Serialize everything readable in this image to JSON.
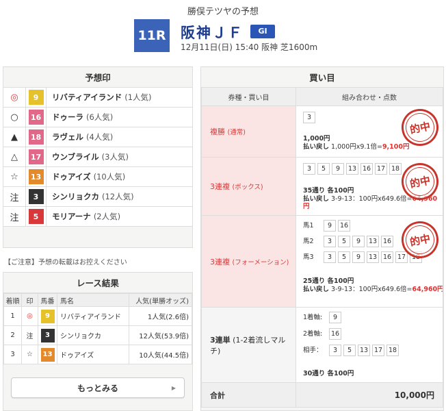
{
  "header": {
    "subtitle": "勝俣テツヤの予想",
    "race_no": "11R",
    "race_name": "阪神ＪＦ",
    "grade": "GI",
    "info": "12月11日(日) 15:40 阪神 芝1600m"
  },
  "prediction": {
    "title": "予想印",
    "rows": [
      {
        "mark": "◎",
        "num": "9",
        "color": "#e5c22b",
        "name": "リバティアイランド",
        "pop": "(1人気)"
      },
      {
        "mark": "○",
        "num": "16",
        "color": "#e2688a",
        "name": "ドゥーラ",
        "pop": "(6人気)"
      },
      {
        "mark": "▲",
        "num": "18",
        "color": "#e2688a",
        "name": "ラヴェル",
        "pop": "(4人気)"
      },
      {
        "mark": "△",
        "num": "17",
        "color": "#e2688a",
        "name": "ウンブライル",
        "pop": "(3人気)"
      },
      {
        "mark": "☆",
        "num": "13",
        "color": "#e28a2c",
        "name": "ドゥアイズ",
        "pop": "(10人気)"
      },
      {
        "mark": "注",
        "num": "3",
        "color": "#333333",
        "name": "シンリョクカ",
        "pop": "(12人気)"
      },
      {
        "mark": "注",
        "num": "5",
        "color": "#d9383a",
        "name": "モリアーナ",
        "pop": "(2人気)"
      }
    ],
    "note": "【ご注意】予想の転載はお控えください"
  },
  "result": {
    "title": "レース結果",
    "headers": [
      "着順",
      "印",
      "馬番",
      "馬名",
      "人気(単勝オッズ)"
    ],
    "rows": [
      {
        "rank": "1",
        "mark": "◎",
        "num": "9",
        "color": "#e5c22b",
        "name": "リバティアイランド",
        "pop": "1人気(2.6倍)"
      },
      {
        "rank": "2",
        "mark": "注",
        "num": "3",
        "color": "#333333",
        "name": "シンリョクカ",
        "pop": "12人気(53.9倍)"
      },
      {
        "rank": "3",
        "mark": "☆",
        "num": "13",
        "color": "#e28a2c",
        "name": "ドゥアイズ",
        "pop": "10人気(44.5倍)"
      }
    ],
    "more": "もっとみる"
  },
  "bets": {
    "title": "買い目",
    "col1": "券種・買い目",
    "col2": "組み合わせ・点数",
    "hit_label": "的中",
    "b1": {
      "type": "複勝",
      "type_sub": "(通常)",
      "nums": [
        "3"
      ],
      "amount": "1,000円",
      "refund_label": "払い戻し",
      "refund_calc": "1,000円x9.1倍=",
      "refund_total": "9,100円"
    },
    "b2": {
      "type": "3連複",
      "type_sub": "(ボックス)",
      "nums": [
        "3",
        "5",
        "9",
        "13",
        "16",
        "17",
        "18"
      ],
      "amount": "35通り 各100円",
      "refund_label": "払い戻し",
      "refund_calc": "3-9-13：100円x649.6倍=",
      "refund_total": "64,960",
      "refund_unit": "円"
    },
    "b3": {
      "type": "3連複",
      "type_sub": "(フォーメーション)",
      "rows": [
        {
          "label": "馬1",
          "nums": [
            "9",
            "16"
          ]
        },
        {
          "label": "馬2",
          "nums": [
            "3",
            "5",
            "9",
            "13",
            "16"
          ]
        },
        {
          "label": "馬3",
          "nums": [
            "3",
            "5",
            "9",
            "13",
            "16",
            "17",
            "18"
          ]
        }
      ],
      "amount": "25通り 各100円",
      "refund_label": "払い戻し",
      "refund_calc": "3-9-13：100円x649.6倍=",
      "refund_total": "64,960",
      "refund_unit": "円"
    },
    "b4": {
      "type": "3連単",
      "type_sub": "(1-2着流しマルチ)",
      "rows": [
        {
          "label": "1着軸:",
          "nums": [
            "9"
          ]
        },
        {
          "label": "2着軸:",
          "nums": [
            "16"
          ]
        },
        {
          "label": "相手：",
          "nums": [
            "3",
            "5",
            "13",
            "17",
            "18"
          ]
        }
      ],
      "amount": "30通り 各100円"
    },
    "total_label": "合計",
    "total": "10,000円"
  }
}
